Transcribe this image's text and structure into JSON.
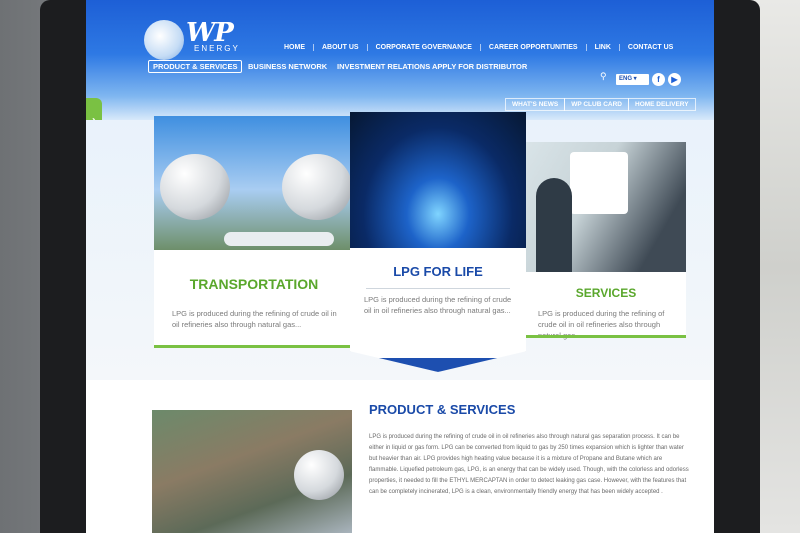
{
  "logo": {
    "name": "WP",
    "subtitle": "ENERGY"
  },
  "top_nav": [
    "HOME",
    "ABOUT US",
    "CORPORATE GOVERNANCE",
    "CAREER OPPORTUNITIES",
    "LINK",
    "CONTACT US"
  ],
  "language": "ENG",
  "main_nav": [
    "PRODUCT & SERVICES",
    "BUSINESS NETWORK",
    "INVESTMENT RELATIONS",
    "APPLY FOR DISTRIBUTOR"
  ],
  "sub_nav": [
    "WHAT'S NEWS",
    "WP CLUB CARD",
    "HOME DELIVERY"
  ],
  "cards": {
    "transportation": {
      "title": "TRANSPORTATION",
      "text": "LPG is produced during the refining of crude oil in oil refineries also through natural gas..."
    },
    "lpg": {
      "title": "LPG FOR LIFE",
      "text": "LPG is produced during the refining of crude oil in oil refineries also through natural gas..."
    },
    "services": {
      "title": "SERVICES",
      "text": "LPG is produced during the refining of crude oil in oil refineries also through natural gas..."
    }
  },
  "section": {
    "title": "PRODUCT & SERVICES",
    "text": "LPG is produced during the refining of crude oil in oil refineries also through natural gas separation process. It can be either in liquid or gas form. LPG can be converted from liquid to gas by 250 times expansion which is lighter than water but heavier than air. LPG provides high heating value because it is a mixture of Propane and Butane which are flammable. Liquefied petroleum gas, LPG, is an energy that can be widely used. Though, with the colorless and odorless properties, it needed to fill the ETHYL MERCAPTAN in order to detect leaking gas case. However, with the features that can be completely incinerated, LPG is a clean, environmentally friendly energy that has been widely accepted ."
  },
  "colors": {
    "header_blue": "#1d5fd6",
    "accent_green": "#7ac143",
    "title_green": "#5aa72c",
    "title_blue": "#1a4aa8"
  },
  "icons": [
    "search-icon",
    "facebook-icon",
    "youtube-icon",
    "chevron-right-icon"
  ]
}
